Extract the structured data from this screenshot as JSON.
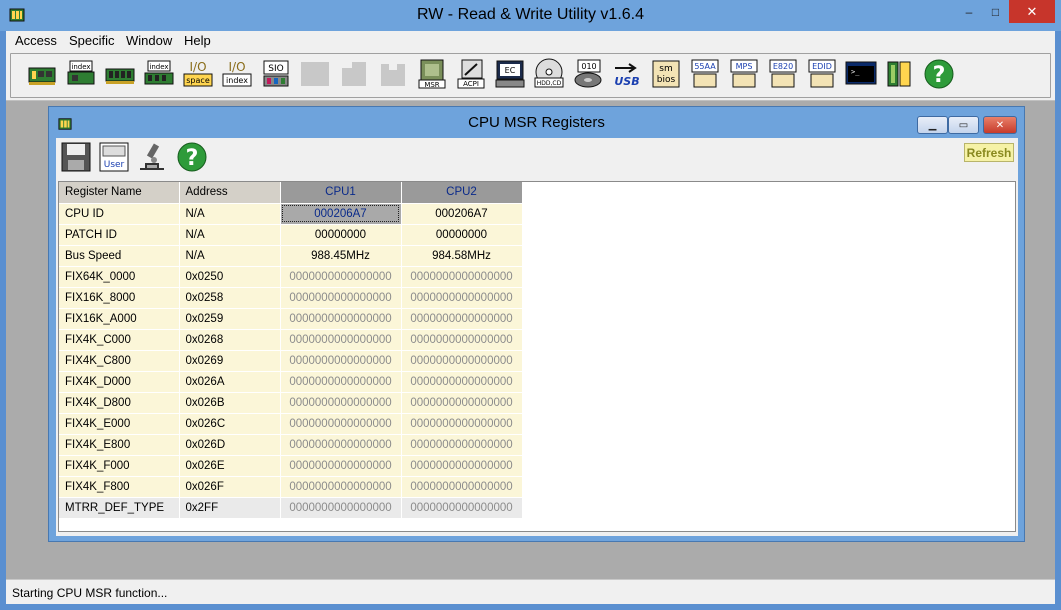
{
  "app": {
    "title": "RW - Read & Write Utility v1.6.4",
    "icon": "rw-app-icon",
    "window_controls": {
      "minimize": "–",
      "maximize": "□",
      "close": "✕"
    }
  },
  "menu": {
    "items": [
      "Access",
      "Specific",
      "Window",
      "Help"
    ]
  },
  "toolbar": {
    "buttons": [
      {
        "name": "pci-icon",
        "label": ""
      },
      {
        "name": "pci-index-icon",
        "label": "index"
      },
      {
        "name": "memory-icon",
        "label": ""
      },
      {
        "name": "memory-index-icon",
        "label": "index"
      },
      {
        "name": "io-space-icon",
        "label": "space"
      },
      {
        "name": "io-index-icon",
        "label": "index"
      },
      {
        "name": "sio-icon",
        "label": "SIO"
      },
      {
        "name": "disabled-1-icon",
        "label": ""
      },
      {
        "name": "disabled-2-icon",
        "label": ""
      },
      {
        "name": "disabled-3-icon",
        "label": ""
      },
      {
        "name": "msr-icon",
        "label": "MSR"
      },
      {
        "name": "acpi-icon",
        "label": "ACPI"
      },
      {
        "name": "ec-icon",
        "label": "EC"
      },
      {
        "name": "hdd-cd-icon",
        "label": "HDD,CD"
      },
      {
        "name": "disk-010-icon",
        "label": "010"
      },
      {
        "name": "usb-icon",
        "label": "USB"
      },
      {
        "name": "smbios-icon",
        "label": "sm bios"
      },
      {
        "name": "55aa-icon",
        "label": "55AA"
      },
      {
        "name": "mps-icon",
        "label": "MPS"
      },
      {
        "name": "e820-icon",
        "label": "E820"
      },
      {
        "name": "edid-icon",
        "label": "EDID"
      },
      {
        "name": "command-icon",
        "label": ""
      },
      {
        "name": "battery-icon",
        "label": ""
      },
      {
        "name": "help-icon",
        "label": "?"
      }
    ]
  },
  "child_window": {
    "title": "CPU MSR Registers",
    "toolbar": [
      {
        "name": "save-icon",
        "label": ""
      },
      {
        "name": "user-icon",
        "label": "User"
      },
      {
        "name": "microscope-icon",
        "label": ""
      },
      {
        "name": "help-icon",
        "label": "?"
      }
    ],
    "refresh_label": "Refresh"
  },
  "grid": {
    "headers": [
      "Register Name",
      "Address",
      "CPU1",
      "CPU2"
    ],
    "rows": [
      [
        "CPU ID",
        "N/A",
        "000206A7",
        "000206A7"
      ],
      [
        "PATCH ID",
        "N/A",
        "00000000",
        "00000000"
      ],
      [
        "Bus Speed",
        "N/A",
        "988.45MHz",
        "984.58MHz"
      ],
      [
        "FIX64K_0000",
        "0x0250",
        "0000000000000000",
        "0000000000000000"
      ],
      [
        "FIX16K_8000",
        "0x0258",
        "0000000000000000",
        "0000000000000000"
      ],
      [
        "FIX16K_A000",
        "0x0259",
        "0000000000000000",
        "0000000000000000"
      ],
      [
        "FIX4K_C000",
        "0x0268",
        "0000000000000000",
        "0000000000000000"
      ],
      [
        "FIX4K_C800",
        "0x0269",
        "0000000000000000",
        "0000000000000000"
      ],
      [
        "FIX4K_D000",
        "0x026A",
        "0000000000000000",
        "0000000000000000"
      ],
      [
        "FIX4K_D800",
        "0x026B",
        "0000000000000000",
        "0000000000000000"
      ],
      [
        "FIX4K_E000",
        "0x026C",
        "0000000000000000",
        "0000000000000000"
      ],
      [
        "FIX4K_E800",
        "0x026D",
        "0000000000000000",
        "0000000000000000"
      ],
      [
        "FIX4K_F000",
        "0x026E",
        "0000000000000000",
        "0000000000000000"
      ],
      [
        "FIX4K_F800",
        "0x026F",
        "0000000000000000",
        "0000000000000000"
      ],
      [
        "MTRR_DEF_TYPE",
        "0x2FF",
        "0000000000000000",
        "0000000000000000"
      ]
    ]
  },
  "status": {
    "text": "Starting CPU MSR function..."
  },
  "colors": {
    "titlebar": "#6ea3dc",
    "close_button": "#c7352b",
    "grid_cell": "#fbf6d8",
    "cpu_header": "#9a9a9a",
    "refresh_button": "#f6f2a6"
  }
}
